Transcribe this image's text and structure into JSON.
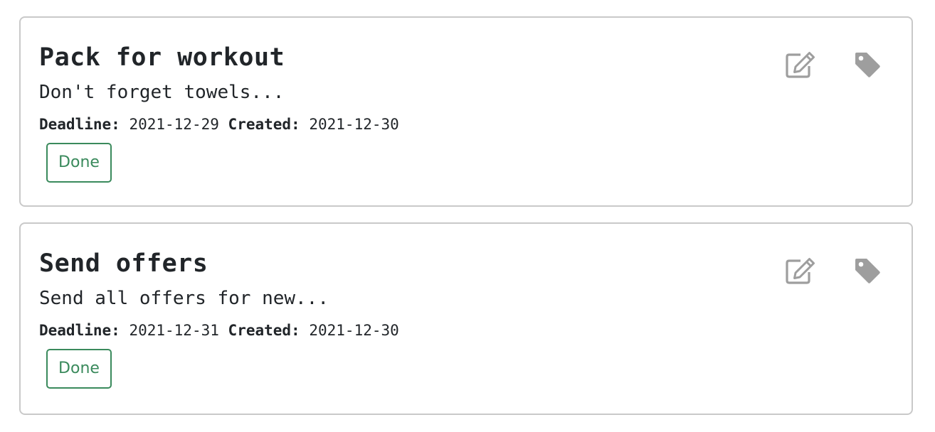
{
  "tasks": [
    {
      "title": "Pack for workout",
      "description": "Don't forget towels...",
      "deadline_label": "Deadline:",
      "deadline": "2021-12-29",
      "created_label": "Created:",
      "created": "2021-12-30",
      "done_label": "Done",
      "edit_icon": "edit-icon",
      "tag_icon": "tag-icon"
    },
    {
      "title": "Send offers",
      "description": "Send all offers for new...",
      "deadline_label": "Deadline:",
      "deadline": "2021-12-31",
      "created_label": "Created:",
      "created": "2021-12-30",
      "done_label": "Done",
      "edit_icon": "edit-icon",
      "tag_icon": "tag-icon"
    }
  ],
  "colors": {
    "done_green": "#3a8a5c",
    "icon_gray": "#9e9e9e",
    "card_border": "#c9c9c9",
    "text": "#212529"
  }
}
